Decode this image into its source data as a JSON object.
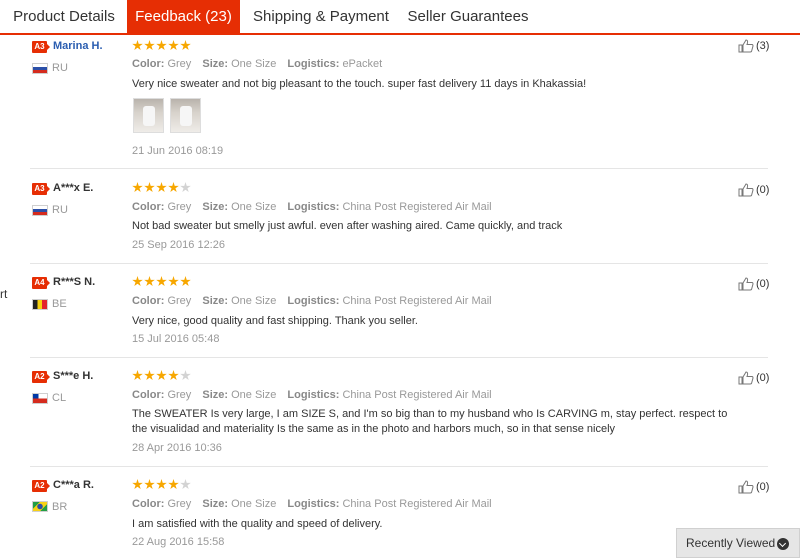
{
  "tabs": [
    {
      "label": "Product Details"
    },
    {
      "label": "Feedback (23)"
    },
    {
      "label": "Shipping & Payment"
    },
    {
      "label": "Seller Guarantees"
    }
  ],
  "stray_text": "rt",
  "labels": {
    "color": "Color:",
    "size": "Size:",
    "logistics": "Logistics:"
  },
  "reviews": [
    {
      "badge": "A3",
      "name": "Marina H.",
      "country": "RU",
      "rating": 5,
      "color": "Grey",
      "size": "One Size",
      "logistics": "ePacket",
      "text": "Very nice sweater and not big pleasant to the touch. super fast delivery 11 days in Khakassia!",
      "date": "21 Jun 2016 08:19",
      "helpful": "(3)"
    },
    {
      "badge": "A3",
      "name": "A***x E.",
      "country": "RU",
      "rating": 4,
      "color": "Grey",
      "size": "One Size",
      "logistics": "China Post Registered Air Mail",
      "text": "Not bad sweater but smelly just awful. even after washing aired. Came quickly, and track",
      "date": "25 Sep 2016 12:26",
      "helpful": "(0)"
    },
    {
      "badge": "A4",
      "name": "R***S N.",
      "country": "BE",
      "rating": 5,
      "color": "Grey",
      "size": "One Size",
      "logistics": "China Post Registered Air Mail",
      "text": "Very nice, good quality and fast shipping. Thank you seller.",
      "date": "15 Jul 2016 05:48",
      "helpful": "(0)"
    },
    {
      "badge": "A2",
      "name": "S***e H.",
      "country": "CL",
      "rating": 4,
      "color": "Grey",
      "size": "One Size",
      "logistics": "China Post Registered Air Mail",
      "text": "The SWEATER Is very large, I am SIZE S, and I'm so big than to my husband who Is CARVING m, stay perfect. respect to the visualidad and materiality Is the same as in the photo and harbors much, so in that sense nicely",
      "date": "28 Apr 2016 10:36",
      "helpful": "(0)"
    },
    {
      "badge": "A2",
      "name": "C***a R.",
      "country": "BR",
      "rating": 4,
      "color": "Grey",
      "size": "One Size",
      "logistics": "China Post Registered Air Mail",
      "text": "I am satisfied with the quality and speed of delivery.",
      "date": "22 Aug 2016 15:58",
      "helpful": "(0)"
    }
  ],
  "recently_viewed": {
    "label": "Recently Viewed",
    "icon": "chevron-down-icon"
  },
  "colors": {
    "accent": "#e62e04",
    "star": "#f7a700",
    "link": "#2a5db0"
  }
}
